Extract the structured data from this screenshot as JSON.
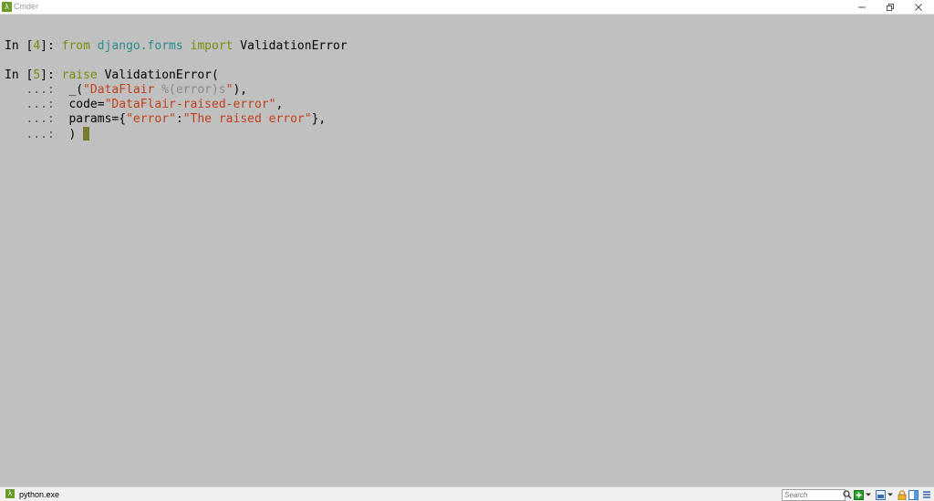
{
  "window": {
    "title": "Cmder",
    "app_icon_glyph": "λ",
    "controls": {
      "minimize": "minimize-icon",
      "maximize": "restore-icon",
      "close": "close-icon"
    }
  },
  "terminal": {
    "lines": [
      {
        "prompt_in": "In [",
        "prompt_num": "4",
        "prompt_close": "]: ",
        "kw1": "from",
        "sp1": " ",
        "mod": "django.forms",
        "sp2": " ",
        "kw2": "import",
        "rest": " ValidationError"
      },
      {
        "prompt_in": "In [",
        "prompt_num": "5",
        "prompt_close": "]: ",
        "kw": "raise",
        "rest": " ValidationError("
      },
      {
        "cont": "   ...: ",
        "pre": " _(",
        "str1": "\"DataFlair ",
        "interp": "%(error)s",
        "str2": "\"",
        "post": "),"
      },
      {
        "cont": "   ...: ",
        "pre": " code=",
        "str": "\"DataFlair-raised-error\"",
        "post": ","
      },
      {
        "cont": "   ...: ",
        "pre": " params={",
        "str1": "\"error\"",
        "mid": ":",
        "str2": "\"The raised error\"",
        "post": "},"
      },
      {
        "cont": "   ...: ",
        "pre": " ) "
      }
    ]
  },
  "statusbar": {
    "process": "python.exe",
    "icon_glyph": "λ",
    "search_placeholder": "Search",
    "tools": [
      "search-icon",
      "new-console-icon",
      "dropdown-icon",
      "layout-icon",
      "dropdown-icon",
      "lock-icon",
      "split-icon",
      "menu-icon"
    ]
  },
  "colors": {
    "terminal_bg": "#c0c0c0",
    "keyword": "#7a8a0a",
    "module": "#2a8a8a",
    "string": "#c0401a",
    "interp": "#8a8a8a",
    "cursor": "#7a7a30"
  }
}
